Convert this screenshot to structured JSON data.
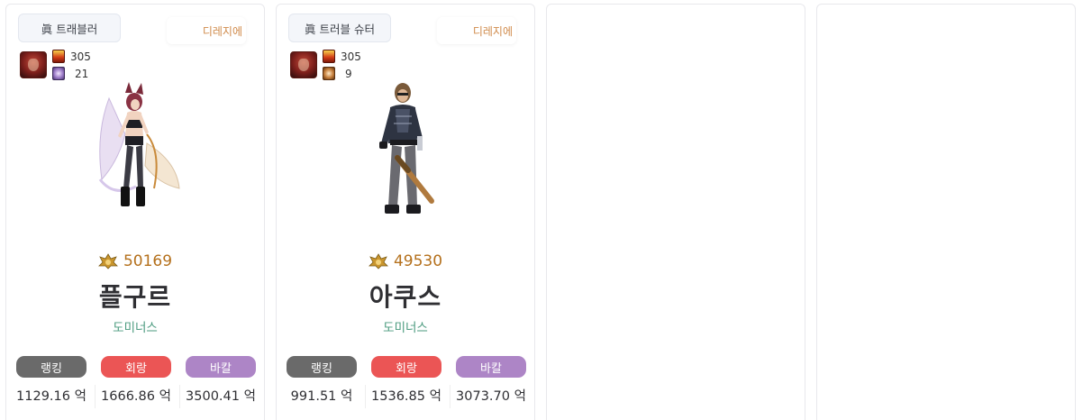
{
  "cards": [
    {
      "job": "眞 트래블러",
      "adventure": "디레지에",
      "buff_level": "305",
      "aura_level": "21",
      "fame": "50169",
      "name": "플구르",
      "server": "도미너스",
      "metrics": [
        {
          "label": "랭킹",
          "value": "1129.16 억",
          "color": "#6a6a6a"
        },
        {
          "label": "회랑",
          "value": "1666.86 억",
          "color": "#eb5555"
        },
        {
          "label": "바칼",
          "value": "3500.41 억",
          "color": "#ad85c6"
        }
      ]
    },
    {
      "job": "眞 트러블 슈터",
      "adventure": "디레지에",
      "buff_level": "305",
      "aura_level": "9",
      "fame": "49530",
      "name": "아쿠스",
      "server": "도미너스",
      "metrics": [
        {
          "label": "랭킹",
          "value": "991.51 억",
          "color": "#6a6a6a"
        },
        {
          "label": "회랑",
          "value": "1536.85 억",
          "color": "#eb5555"
        },
        {
          "label": "바칼",
          "value": "3073.70 억",
          "color": "#ad85c6"
        }
      ]
    }
  ],
  "icons": {
    "buff_avatar": "buff-avatar-icon",
    "buff_level": "fire-emblem-icon",
    "aura": "aura-icon",
    "fame": "fame-crest-icon"
  },
  "colors": {
    "fame": "#b4701c",
    "server": "#4a9a7e",
    "adventure": "#d08a4a"
  }
}
